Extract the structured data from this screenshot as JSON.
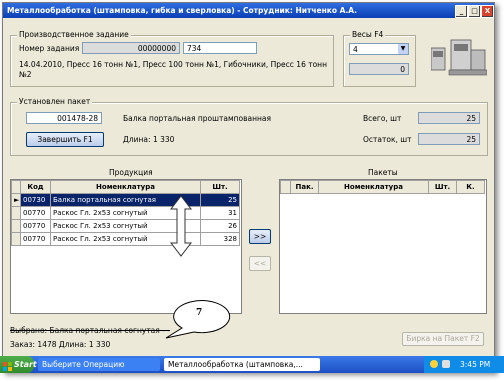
{
  "window": {
    "title": "Металлообработка (штамповка, гибка и сверловка) - Сотрудник: Нитченко А.А.",
    "controls": [
      "_",
      "□",
      "X"
    ]
  },
  "production_task": {
    "group_label": "Производственное задание",
    "task_number_label": "Номер задания",
    "task_number_value": "00000000",
    "task_number_extra": "734",
    "description": "14.04.2010, Пресс 16 тонн №1, Пресс 100 тонн №1, Гибочники, Пресс 16 тонн №2"
  },
  "scales": {
    "group_label": "Весы  F4",
    "selected": "4",
    "value": "0"
  },
  "package": {
    "group_label": "Установлен пакет",
    "package_id": "001478-28",
    "name": "Балка портальная проштампованная",
    "length": "Длина: 1 330",
    "finish_button": "Завершить      F1",
    "total_label": "Всего, шт",
    "total_value": "25",
    "remaining_label": "Остаток, шт",
    "remaining_value": "25"
  },
  "products": {
    "group_label": "Продукция",
    "columns": [
      "Код",
      "Номенклатура",
      "Шт."
    ],
    "rows": [
      {
        "marker": "►",
        "code": "00730",
        "name": "Балка портальная согнутая",
        "qty": "25"
      },
      {
        "marker": "",
        "code": "00770",
        "name": "Раскос Гл. 2х53 согнутый",
        "qty": "31"
      },
      {
        "marker": "",
        "code": "00770",
        "name": "Раскос Гл. 2х53 согнутый",
        "qty": "26"
      },
      {
        "marker": "",
        "code": "00770",
        "name": "Раскос Гл. 2х53 согнутый",
        "qty": "328"
      }
    ]
  },
  "packets": {
    "group_label": "Пакеты",
    "columns": [
      "Пак.",
      "Номенклатура",
      "Шт.",
      "К."
    ]
  },
  "transfer": {
    "add_label": ">>",
    "remove_label": "<<"
  },
  "callout": {
    "number": "7"
  },
  "status": {
    "selected_line": "Выбрано: Балка портальная согнутая - -",
    "order_line": "Заказ: 1478  Длина: 1 330",
    "tag_button": "Бирка на Пакет   F2"
  },
  "taskbar": {
    "start": "Start",
    "tasks": [
      "Выберите Операцию",
      "Металлообработка (штамповка,..."
    ],
    "time": "3:45 PM"
  },
  "colors": {
    "selection": "#0a246a",
    "titlebar": "#0a3fb4",
    "taskbar": "#1d4fc4"
  }
}
